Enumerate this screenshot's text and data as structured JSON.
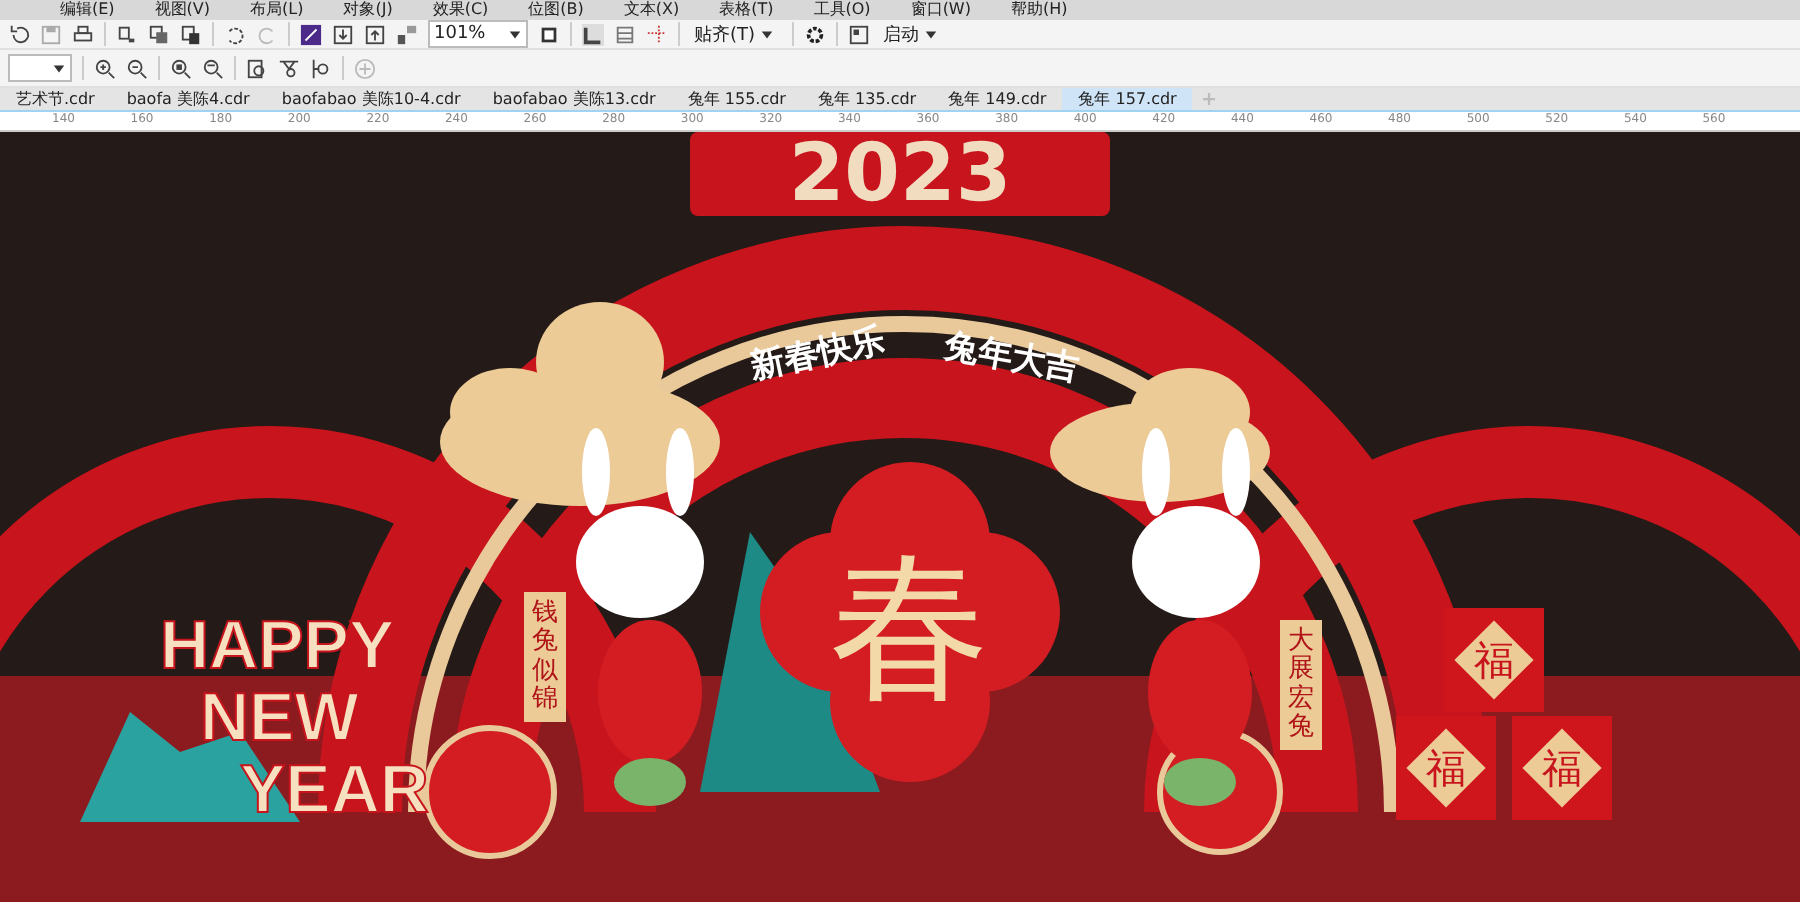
{
  "menu": [
    "编辑(E)",
    "视图(V)",
    "布局(L)",
    "对象(J)",
    "效果(C)",
    "位图(B)",
    "文本(X)",
    "表格(T)",
    "工具(O)",
    "窗口(W)",
    "帮助(H)"
  ],
  "toolbar": {
    "zoom": "101%",
    "snap": "贴齐(T)",
    "launch": "启动"
  },
  "tabs": [
    {
      "label": "艺术节.cdr",
      "selected": false
    },
    {
      "label": "baofa 美陈4.cdr",
      "selected": false
    },
    {
      "label": "baofabao 美陈10-4.cdr",
      "selected": false
    },
    {
      "label": "baofabao 美陈13.cdr",
      "selected": false
    },
    {
      "label": "兔年 155.cdr",
      "selected": false
    },
    {
      "label": "兔年 135.cdr",
      "selected": false
    },
    {
      "label": "兔年 149.cdr",
      "selected": false
    },
    {
      "label": "兔年 157.cdr",
      "selected": true
    }
  ],
  "ruler": [
    "140",
    "160",
    "180",
    "200",
    "220",
    "240",
    "260",
    "280",
    "300",
    "320",
    "340",
    "360",
    "380",
    "400",
    "420",
    "440",
    "460",
    "480",
    "500",
    "520",
    "540",
    "560"
  ],
  "artwork": {
    "year": "2023",
    "banner_left": "新春快乐",
    "banner_right": "兔年大吉",
    "greeting": [
      "HAPPY",
      "NEW",
      "YEAR"
    ],
    "center": "春",
    "scroll_left": "钱兔似锦",
    "scroll_right": "大展宏兔",
    "blocks": [
      "福",
      "福",
      "福"
    ]
  }
}
